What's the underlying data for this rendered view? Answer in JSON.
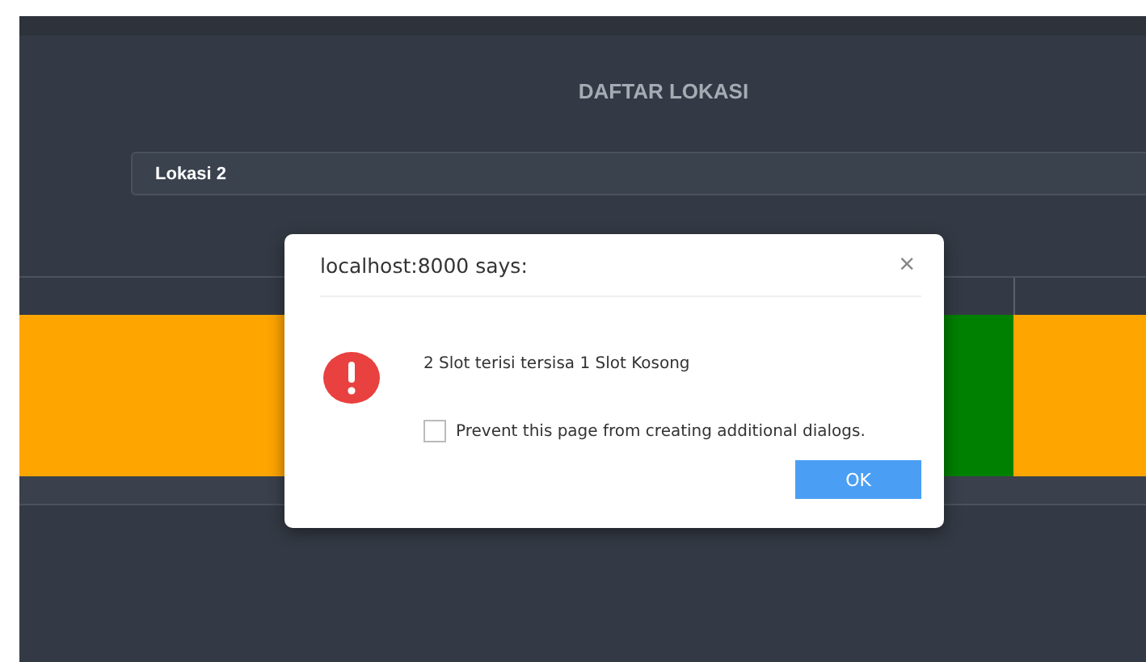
{
  "page": {
    "title": "DAFTAR LOKASI"
  },
  "location_select": {
    "value": "Lokasi 2"
  },
  "slots": [
    {
      "color": "#ffa500"
    },
    {
      "color": "#008000"
    },
    {
      "color": "#ffa500"
    }
  ],
  "dialog": {
    "title": "localhost:8000 says:",
    "close": "×",
    "message": "2 Slot terisi tersisa 1 Slot Kosong",
    "prevent": {
      "label": "Prevent this page from creating additional dialogs.",
      "checked": false
    },
    "button": "OK"
  }
}
